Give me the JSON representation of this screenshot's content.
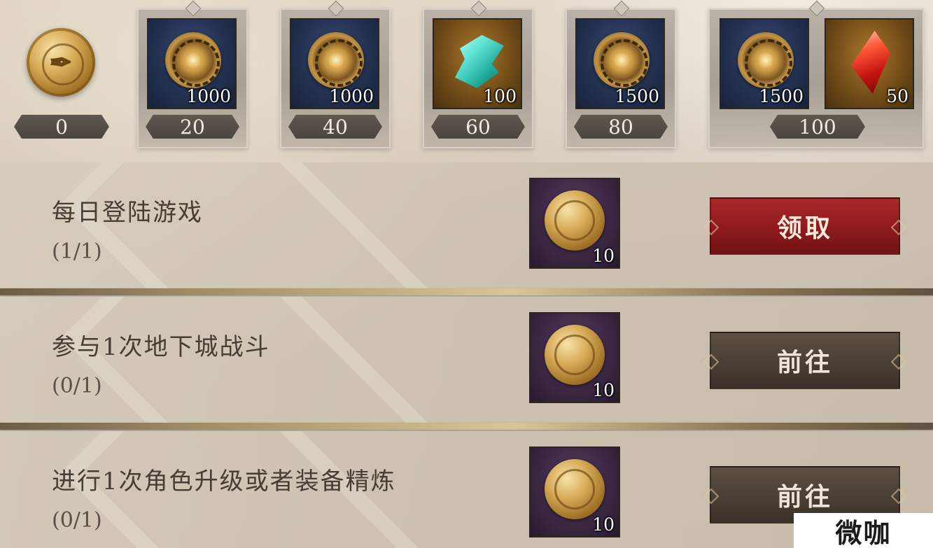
{
  "milestones": {
    "start": {
      "label": "0",
      "icon": "quill-coin-icon"
    },
    "items": [
      {
        "label": "20",
        "rewards": [
          {
            "icon": "gold-medal-icon",
            "qty": "1000"
          }
        ]
      },
      {
        "label": "40",
        "rewards": [
          {
            "icon": "gold-medal-icon",
            "qty": "1000"
          }
        ]
      },
      {
        "label": "60",
        "rewards": [
          {
            "icon": "cyan-crystal-icon",
            "qty": "100"
          }
        ]
      },
      {
        "label": "80",
        "rewards": [
          {
            "icon": "gold-medal-icon",
            "qty": "1500"
          }
        ]
      },
      {
        "label": "100",
        "rewards": [
          {
            "icon": "gold-medal-icon",
            "qty": "1500"
          },
          {
            "icon": "red-crystal-icon",
            "qty": "50"
          }
        ]
      }
    ]
  },
  "tasks": [
    {
      "title": "每日登陆游戏",
      "progress": "(1/1)",
      "reward_qty": "10",
      "reward_icon": "quill-coin-icon",
      "button": "领取"
    },
    {
      "title": "参与1次地下城战斗",
      "progress": "(0/1)",
      "reward_qty": "10",
      "reward_icon": "quill-coin-icon",
      "button": "前往"
    },
    {
      "title": "进行1次角色升级或者装备精炼",
      "progress": "(0/1)",
      "reward_qty": "10",
      "reward_icon": "quill-coin-icon",
      "button": "前往"
    }
  ],
  "watermark": "微咖",
  "colors": {
    "claim_button": "#8e1a1c",
    "go_button": "#4a3f34"
  }
}
